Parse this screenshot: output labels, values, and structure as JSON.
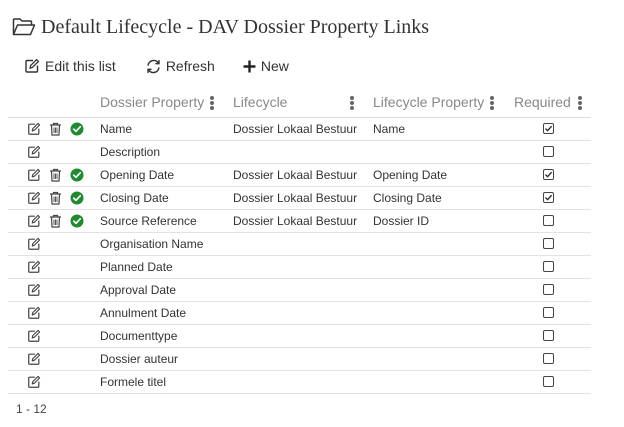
{
  "page": {
    "title": "Default Lifecycle - DAV Dossier Property Links",
    "title_icon": "folder-open-icon"
  },
  "toolbar": {
    "edit_label": "Edit this list",
    "refresh_label": "Refresh",
    "new_label": "New"
  },
  "columns": {
    "dossier_property": "Dossier Property",
    "lifecycle": "Lifecycle",
    "lifecycle_property": "Lifecycle Property",
    "required": "Required"
  },
  "rows": [
    {
      "dossier_property": "Name",
      "lifecycle": "Dossier Lokaal Bestuur",
      "lifecycle_property": "Name",
      "required": true,
      "linked": true
    },
    {
      "dossier_property": "Description",
      "lifecycle": "",
      "lifecycle_property": "",
      "required": false,
      "linked": false
    },
    {
      "dossier_property": "Opening Date",
      "lifecycle": "Dossier Lokaal Bestuur",
      "lifecycle_property": "Opening Date",
      "required": true,
      "linked": true
    },
    {
      "dossier_property": "Closing Date",
      "lifecycle": "Dossier Lokaal Bestuur",
      "lifecycle_property": "Closing Date",
      "required": true,
      "linked": true
    },
    {
      "dossier_property": "Source Reference",
      "lifecycle": "Dossier Lokaal Bestuur",
      "lifecycle_property": "Dossier ID",
      "required": false,
      "linked": true
    },
    {
      "dossier_property": "Organisation Name",
      "lifecycle": "",
      "lifecycle_property": "",
      "required": false,
      "linked": false
    },
    {
      "dossier_property": "Planned Date",
      "lifecycle": "",
      "lifecycle_property": "",
      "required": false,
      "linked": false
    },
    {
      "dossier_property": "Approval Date",
      "lifecycle": "",
      "lifecycle_property": "",
      "required": false,
      "linked": false
    },
    {
      "dossier_property": "Annulment Date",
      "lifecycle": "",
      "lifecycle_property": "",
      "required": false,
      "linked": false
    },
    {
      "dossier_property": "Documenttype",
      "lifecycle": "",
      "lifecycle_property": "",
      "required": false,
      "linked": false
    },
    {
      "dossier_property": "Dossier auteur",
      "lifecycle": "",
      "lifecycle_property": "",
      "required": false,
      "linked": false
    },
    {
      "dossier_property": "Formele titel",
      "lifecycle": "",
      "lifecycle_property": "",
      "required": false,
      "linked": false
    }
  ],
  "footer": {
    "range": "1 - 12"
  },
  "colors": {
    "status_ok": "#1e8c2e",
    "icon": "#444444",
    "header_text": "#888888",
    "border": "#dddddd"
  }
}
